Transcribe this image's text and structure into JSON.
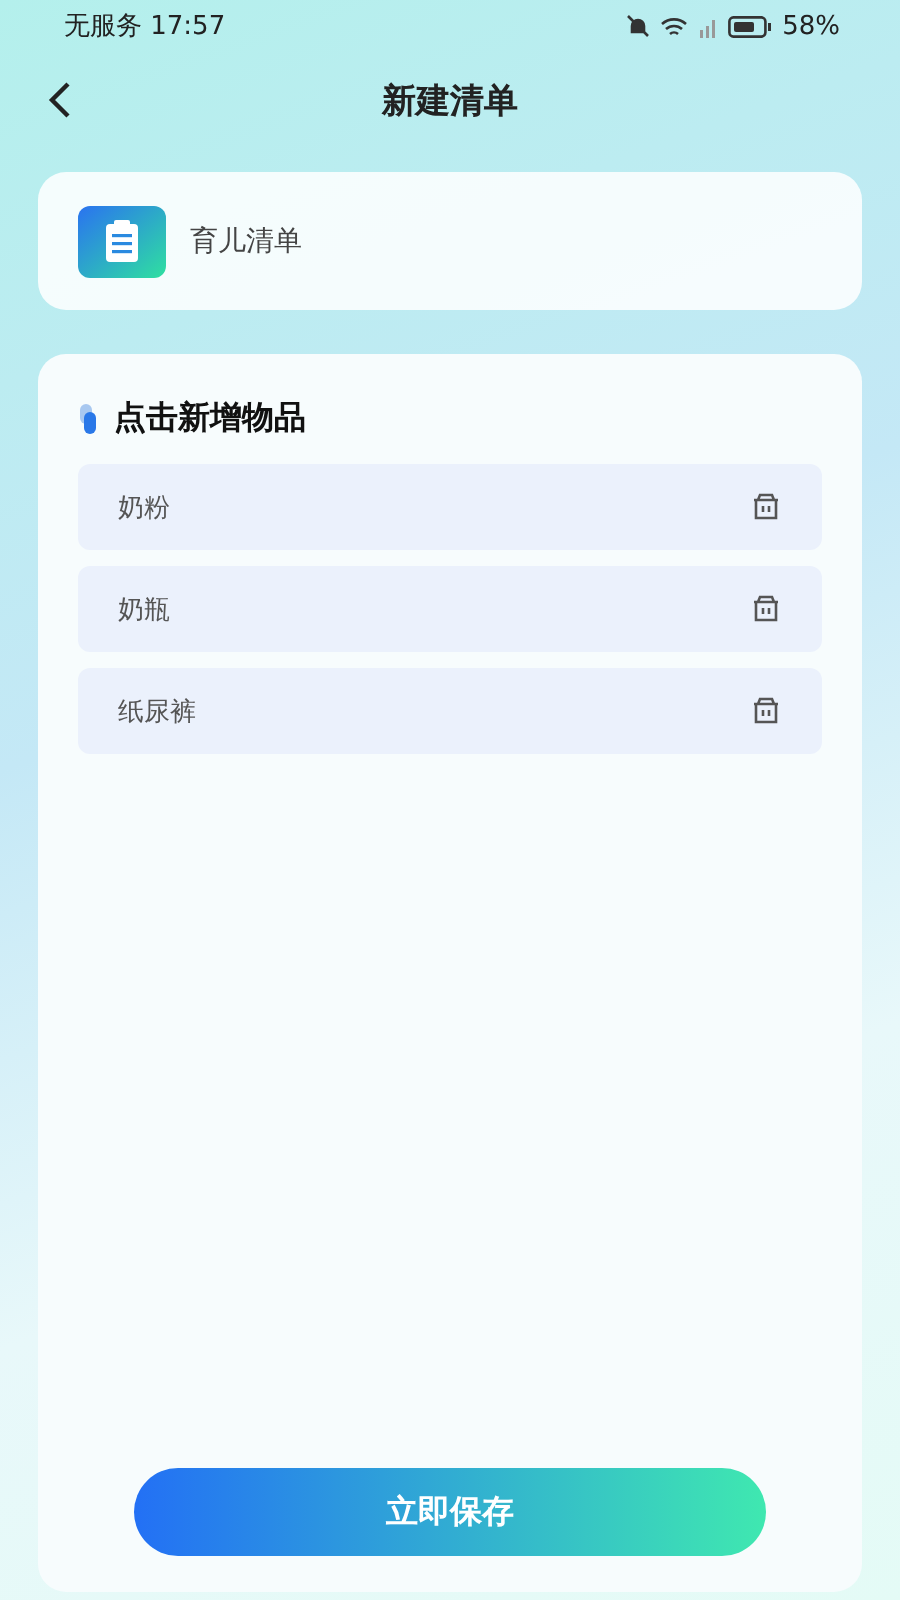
{
  "status_bar": {
    "carrier": "无服务",
    "time": "17:57",
    "battery": "58%"
  },
  "header": {
    "title": "新建清单"
  },
  "list": {
    "name": "育儿清单"
  },
  "items_section": {
    "title": "点击新增物品",
    "items": [
      {
        "name": "奶粉"
      },
      {
        "name": "奶瓶"
      },
      {
        "name": "纸尿裤"
      }
    ]
  },
  "save_button": {
    "label": "立即保存"
  }
}
